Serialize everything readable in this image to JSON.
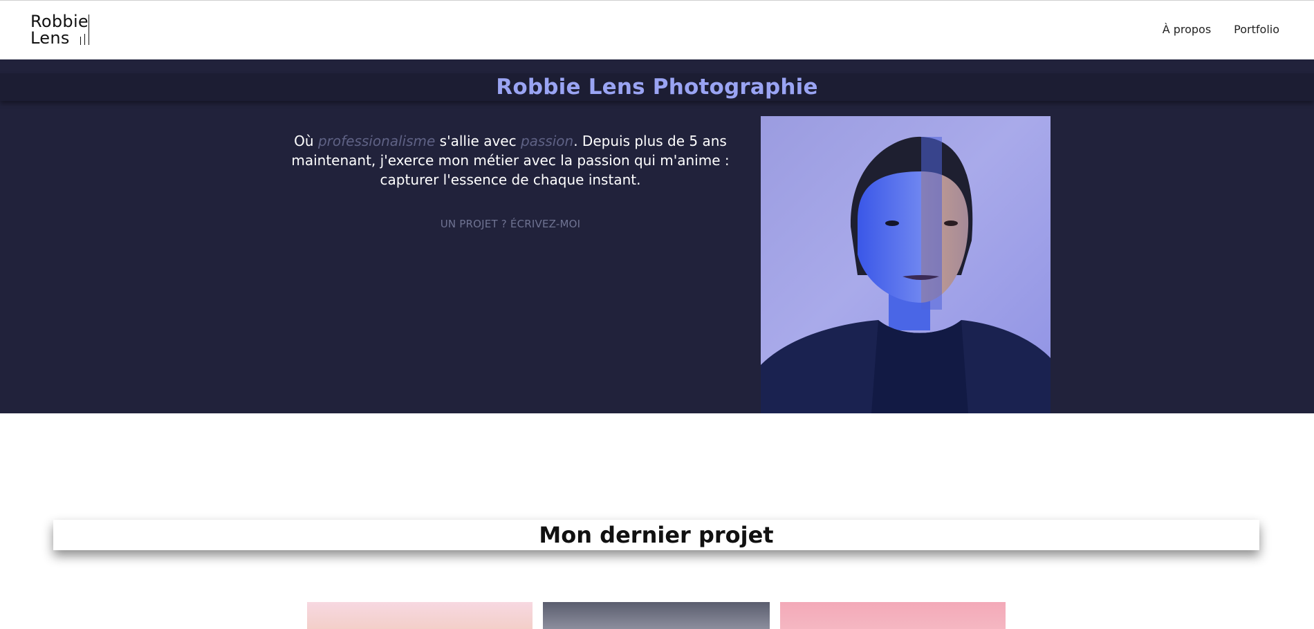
{
  "header": {
    "logo": {
      "line1": "Robbie",
      "line2": "Lens"
    },
    "nav": [
      {
        "label": "À propos"
      },
      {
        "label": "Portfolio"
      }
    ]
  },
  "hero": {
    "title": "Robbie Lens Photographie",
    "intro": {
      "part1": "Où ",
      "em1": "professionalisme",
      "part2": " s'allie avec ",
      "em2": "passion",
      "part3": ". Depuis plus de 5 ans maintenant, j'exerce mon métier avec la passion qui m'anime : capturer l'essence de chaque instant."
    },
    "cta": "UN PROJET ? ÉCRIVEZ-MOI",
    "portrait_icon": "portrait-photo"
  },
  "section": {
    "title": "Mon dernier projet"
  },
  "colors": {
    "hero_bg": "#21223b",
    "accent": "#9aa4f3",
    "muted": "#6f7392"
  }
}
